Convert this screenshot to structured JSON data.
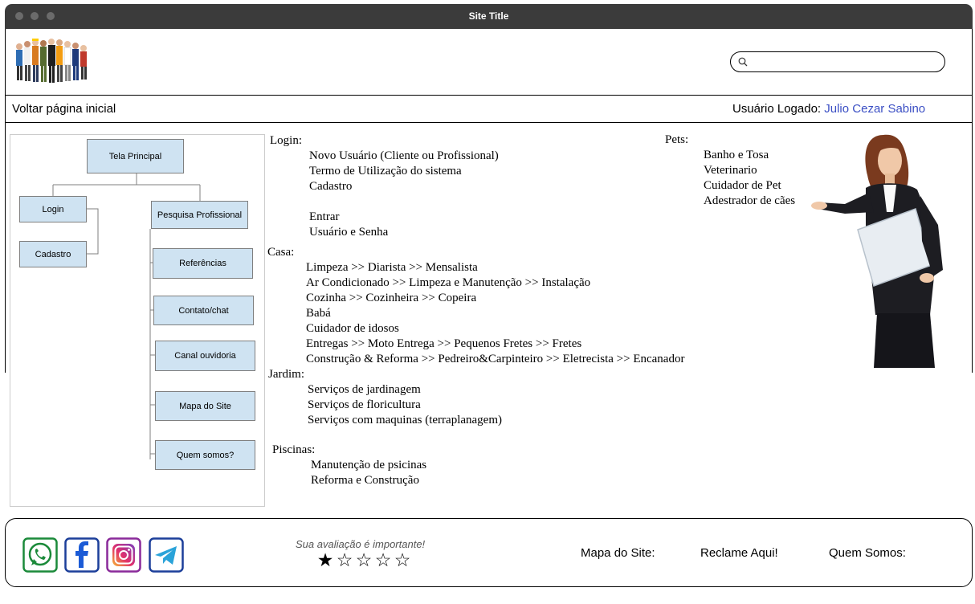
{
  "window": {
    "title": "Site Title"
  },
  "header": {
    "search": {
      "placeholder": ""
    },
    "back_link": "Voltar página inicial",
    "user_label": "Usuário Logado:",
    "user_name": "Julio Cezar Sabino"
  },
  "sitemap": {
    "nodes": [
      "Tela Principal",
      "Login",
      "Cadastro",
      "Pesquisa Profissional",
      "Referências",
      "Contato/chat",
      "Canal ouvidoria",
      "Mapa do Site",
      "Quem somos?"
    ]
  },
  "content": {
    "login": {
      "title": "Login:",
      "items": [
        "Novo Usuário (Cliente ou Profissional)",
        "Termo de Utilização do sistema",
        "Cadastro",
        "Entrar",
        "Usuário e Senha"
      ]
    },
    "casa": {
      "title": "Casa:",
      "items": [
        "Limpeza >> Diarista >> Mensalista",
        "Ar Condicionado >> Limpeza e Manutenção >> Instalação",
        "Cozinha >> Cozinheira >> Copeira",
        "Babá",
        "Cuidador de idosos",
        "Entregas >> Moto Entrega >> Pequenos Fretes >> Fretes",
        "Construção & Reforma >> Pedreiro&Carpinteiro >> Eletrecista >> Encanador"
      ]
    },
    "jardim": {
      "title": "Jardim:",
      "items": [
        "Serviços de jardinagem",
        "Serviços de floricultura",
        "Serviços com maquinas (terraplanagem)"
      ]
    },
    "piscinas": {
      "title": "Piscinas:",
      "items": [
        "Manutenção de psicinas",
        "Reforma e Construção"
      ]
    },
    "pets": {
      "title": "Pets:",
      "items": [
        "Banho e Tosa",
        "Veterinario",
        "Cuidador de Pet",
        "Adestrador de cães"
      ]
    }
  },
  "footer": {
    "social": [
      "whatsapp-icon",
      "facebook-icon",
      "instagram-icon",
      "telegram-icon"
    ],
    "rating_label": "Sua avaliação é importante!",
    "rating": {
      "value": 1,
      "max": 5
    },
    "links": [
      "Mapa do Site:",
      "Reclame Aqui!",
      "Quem Somos:"
    ]
  },
  "colors": {
    "titlebar": "#3b3b3b",
    "node_fill": "#cfe3f2",
    "user_name": "#3b4fc4"
  }
}
